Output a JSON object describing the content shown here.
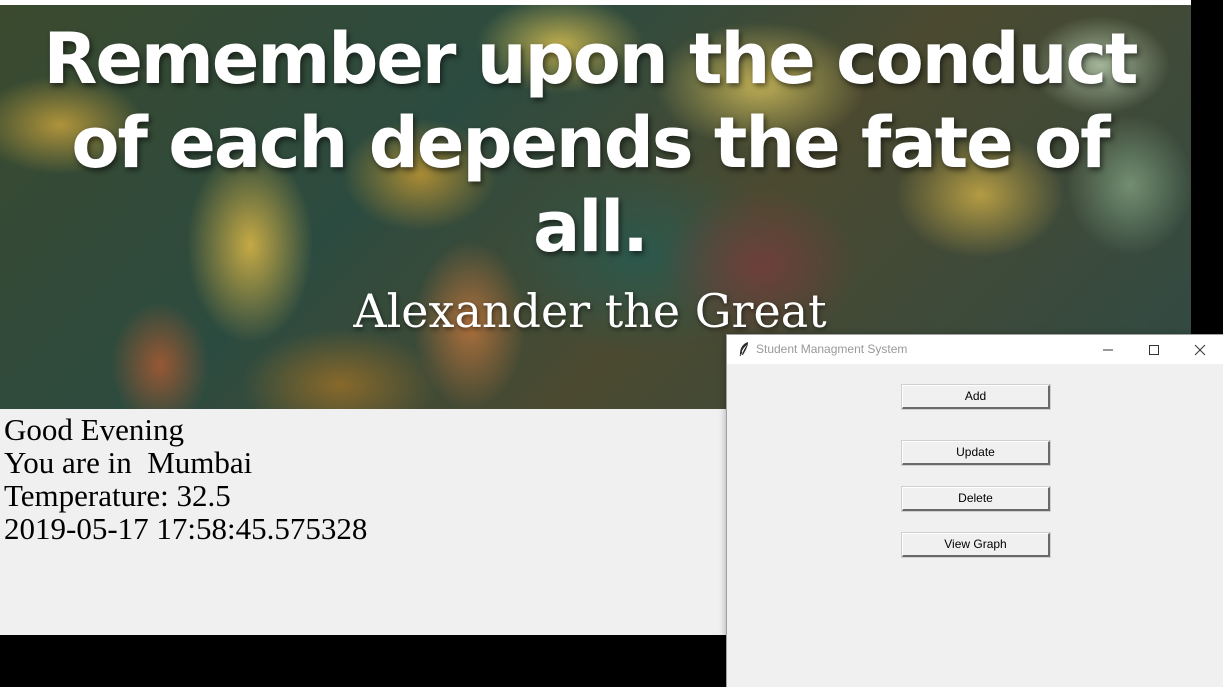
{
  "banner": {
    "quote": "Remember upon the conduct of each depends the fate of all.",
    "author": "Alexander the Great"
  },
  "info": {
    "greeting": "Good Evening",
    "location": "You are in  Mumbai",
    "temperature": "Temperature: 32.5",
    "datetime": "2019-05-17 17:58:45.575328"
  },
  "dialog": {
    "title": "Student Managment System",
    "icon": "feather-icon",
    "buttons": {
      "add": "Add",
      "update": "Update",
      "delete": "Delete",
      "view_graph": "View Graph"
    }
  },
  "colors": {
    "window_bg": "#f0f0f0",
    "titlebar_bg": "#ffffff",
    "title_text": "#999999",
    "desktop": "#000000"
  }
}
